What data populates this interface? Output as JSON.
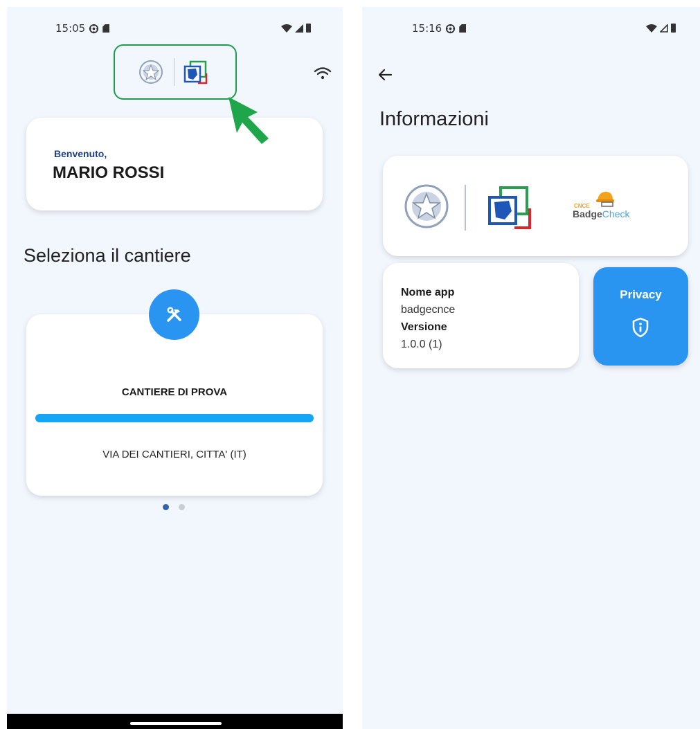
{
  "left": {
    "status": {
      "time": "15:05"
    },
    "welcome": {
      "greeting": "Benvenuto,",
      "name": "MARIO ROSSI"
    },
    "section_title": "Seleziona il cantiere",
    "site": {
      "name": "CANTIERE DI PROVA",
      "address": "VIA DEI CANTIERI, CITTA' (IT)"
    },
    "pager": {
      "total": 2,
      "active": 1
    },
    "icons": {
      "wifi": "wifi-icon",
      "tools": "tools-icon",
      "cursor": "pointer-arrow-icon"
    }
  },
  "right": {
    "status": {
      "time": "15:16"
    },
    "title": "Informazioni",
    "app_info": {
      "name_label": "Nome app",
      "name_value": "badgecnce",
      "version_label": "Versione",
      "version_value": "1.0.0 (1)"
    },
    "privacy_label": "Privacy",
    "badge_logo": {
      "small": "CNCE",
      "part1": "Badge",
      "part2": "Check"
    },
    "icons": {
      "back": "back-arrow-icon",
      "privacy": "shield-info-icon"
    }
  },
  "colors": {
    "background": "#f2f6fd",
    "accent_blue": "#2a95f0",
    "progress_blue": "#12a6f5",
    "highlight_green": "#1e9e4a",
    "welcome_blue": "#1c3f8c"
  }
}
